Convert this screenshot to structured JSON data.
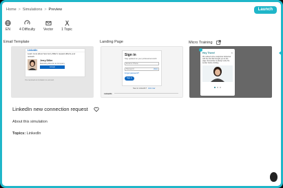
{
  "breadcrumb": {
    "items": [
      "Home",
      "Simulations",
      "Preview"
    ],
    "separator": ">"
  },
  "header": {
    "launch_label": "Launch"
  },
  "meta": [
    {
      "icon": "globe-icon",
      "label": "EN"
    },
    {
      "icon": "gauge-icon",
      "label": "4 Difficulty"
    },
    {
      "icon": "envelope-icon",
      "label": "Vector"
    },
    {
      "icon": "topic-icon",
      "label": "1 Topic"
    }
  ],
  "sections": {
    "email_template": "Email Template",
    "landing_page": "Landing Page",
    "micro_training": "Micro Training"
  },
  "email_preview": {
    "brand": "LinkedIn",
    "header_text": "Learn more about how Jerry Diller's request affects your network.",
    "name": "Jerry Diller",
    "job": "Marketing Director at Company",
    "button": "Accept",
    "footer": "You received an invitation to connect."
  },
  "landing_preview": {
    "title": "Sign in",
    "subtitle": "Stay updated on your professional world",
    "email_placeholder": "Email or Phone",
    "password_placeholder": "Password",
    "show": "show",
    "forgot": "Forgot password?",
    "signin_button": "Sign in",
    "new_text": "New to LinkedIn?",
    "join": "Join now",
    "footer_brand": "LinkedIn"
  },
  "training_preview": {
    "title": "Hey There!",
    "body": "We noticed some suspicious behaviour with the link that brought you to this page. Remember to always verify the sender before clicking.",
    "close": "×"
  },
  "simulation": {
    "title": "LinkedIn new connection request",
    "about": "About this simulation",
    "topics_label": "Topics:",
    "topics_value": "LinkedIn"
  },
  "colors": {
    "accent": "#1fb6c9",
    "linkedin_blue": "#0a66c2",
    "dark": "#0b0b0b"
  }
}
